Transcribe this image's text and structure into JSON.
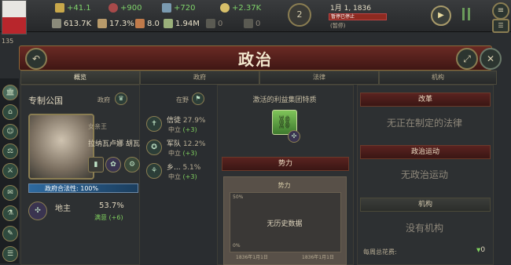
{
  "topbar": {
    "stats_row1": [
      {
        "value": "+41.1",
        "icon": "authority-icon",
        "color": "green"
      },
      {
        "value": "+900",
        "icon": "influence-icon",
        "color": "green"
      },
      {
        "value": "+720",
        "icon": "bureaucracy-icon",
        "color": "green"
      },
      {
        "value": "+2.37K",
        "icon": "money-icon",
        "color": "green"
      }
    ],
    "stats_row2": [
      {
        "value": "613.7K",
        "icon": "gdp-icon"
      },
      {
        "value": "17.3%",
        "icon": "literacy-icon"
      },
      {
        "value": "8.0",
        "icon": "sol-icon"
      },
      {
        "value": "1.94M",
        "icon": "population-icon"
      },
      {
        "value": "0",
        "icon": "army-icon"
      },
      {
        "value": "0",
        "icon": "navy-icon"
      }
    ],
    "notification_count": "2",
    "date": "1月 1, 1836",
    "speed_label": "暂停已停止",
    "status": "(暂停)",
    "side_left_number": "135"
  },
  "header": {
    "title": "政治"
  },
  "tabs": [
    {
      "label": "概览",
      "active": true
    },
    {
      "label": "政府",
      "active": false
    },
    {
      "label": "法律",
      "active": false
    },
    {
      "label": "机构",
      "active": false
    }
  ],
  "government": {
    "type": "专制公国",
    "gov_label": "政府",
    "ruler_title": "女亲王",
    "ruler_name": "拉纳瓦卢娜 胡瓦",
    "legitimacy": "政府合法性: 100%",
    "party_label": "地主",
    "party_percent": "53.7%",
    "party_mood": "满意",
    "party_mood_value": "(+6)",
    "in_opposition_label": "在野",
    "opposition": [
      {
        "name": "信徒",
        "percent": "27.9%",
        "stance": "中立",
        "value": "(+3)"
      },
      {
        "name": "军队",
        "percent": "12.2%",
        "stance": "中立",
        "value": "(+3)"
      },
      {
        "name": "乡...",
        "percent": "5.1%",
        "stance": "中立",
        "value": "(+3)"
      }
    ]
  },
  "middle": {
    "traits_header": "激活的利益集团特质",
    "power_header": "势力",
    "chart_title": "势力",
    "chart_no_data": "无历史数据",
    "chart_y_top": "50%",
    "chart_y_bottom": "0%",
    "chart_x_labels": [
      "1836年1月1日",
      "1836年1月1日"
    ]
  },
  "right": {
    "reform_header": "改革",
    "reform_text": "无正在制定的法律",
    "movement_header": "政治运动",
    "movement_text": "无政治运动",
    "institution_header": "机构",
    "institution_text": "没有机构",
    "weekly_cost_label": "每周总花费:",
    "weekly_cost_value": "0"
  }
}
